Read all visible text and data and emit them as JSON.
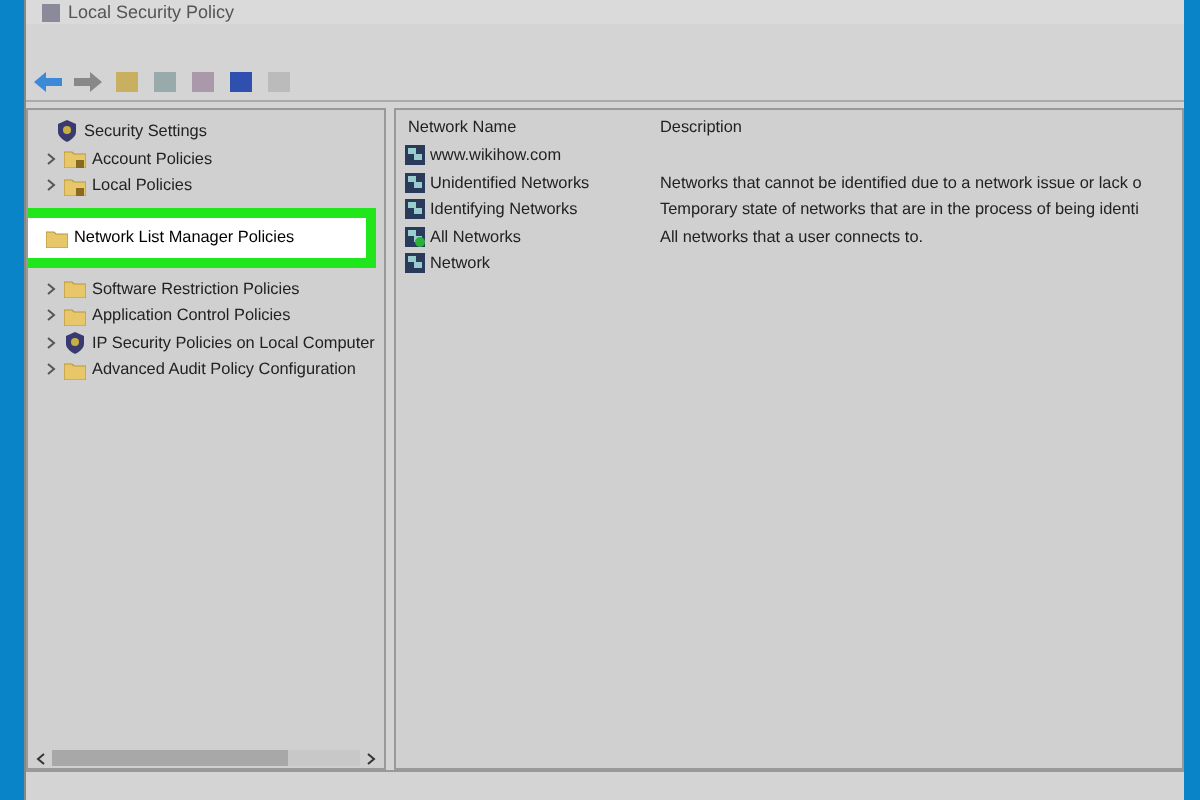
{
  "window": {
    "title": "Local Security Policy"
  },
  "tree": {
    "label": "Security Settings",
    "expanded": true,
    "children": [
      {
        "label": "Account Policies",
        "expandable": true,
        "highlighted": false
      },
      {
        "label": "Local Policies",
        "expandable": true,
        "highlighted": false
      },
      {
        "label": "Network List Manager Policies",
        "expandable": false,
        "highlighted": true
      },
      {
        "label": "Software Restriction Policies",
        "expandable": true,
        "highlighted": false
      },
      {
        "label": "Application Control Policies",
        "expandable": true,
        "highlighted": false
      },
      {
        "label": "IP Security Policies on Local Computer",
        "expandable": true,
        "highlighted": false,
        "kind": "ipsec"
      },
      {
        "label": "Advanced Audit Policy Configuration",
        "expandable": true,
        "highlighted": false
      }
    ]
  },
  "list": {
    "columns": [
      "Network Name",
      "Description"
    ],
    "rows": [
      {
        "name": "www.wikihow.com",
        "description": "",
        "kind": "network"
      },
      {
        "name": "Unidentified Networks",
        "description": "Networks that cannot be identified due to a network issue or lack o",
        "kind": "network"
      },
      {
        "name": "Identifying Networks",
        "description": "Temporary state of networks that are in the process of being identi",
        "kind": "network"
      },
      {
        "name": "All Networks",
        "description": "All networks that a user connects to.",
        "kind": "all"
      },
      {
        "name": "Network",
        "description": "",
        "kind": "network"
      }
    ]
  }
}
